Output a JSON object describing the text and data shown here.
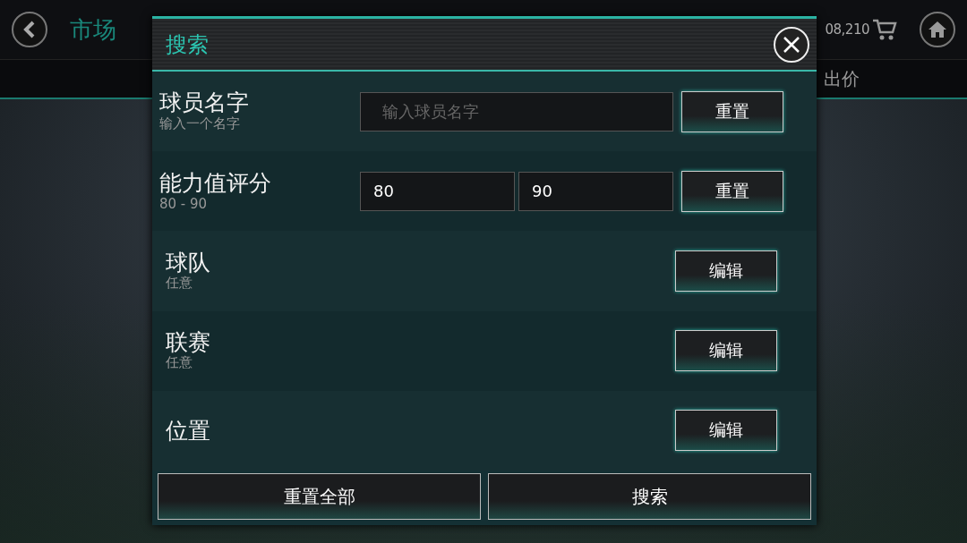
{
  "top_bar": {
    "title": "市场",
    "coins": "08,210"
  },
  "tabs": [
    {
      "label": "出价",
      "selected": false
    }
  ],
  "dialog": {
    "title": "搜索",
    "filters": [
      {
        "kind": "text",
        "label": "球员名字",
        "sub": "输入一个名字",
        "placeholder": "输入球员名字",
        "button": "重置"
      },
      {
        "kind": "range",
        "label": "能力值评分",
        "sub": "80 - 90",
        "min": "80",
        "max": "90",
        "button": "重置"
      },
      {
        "kind": "edit",
        "label": "球队",
        "sub": "任意",
        "button": "编辑"
      },
      {
        "kind": "edit",
        "label": "联赛",
        "sub": "任意",
        "button": "编辑"
      },
      {
        "kind": "edit",
        "label": "位置",
        "button": "编辑"
      }
    ],
    "buttons": [
      "重置全部",
      "搜索"
    ]
  }
}
